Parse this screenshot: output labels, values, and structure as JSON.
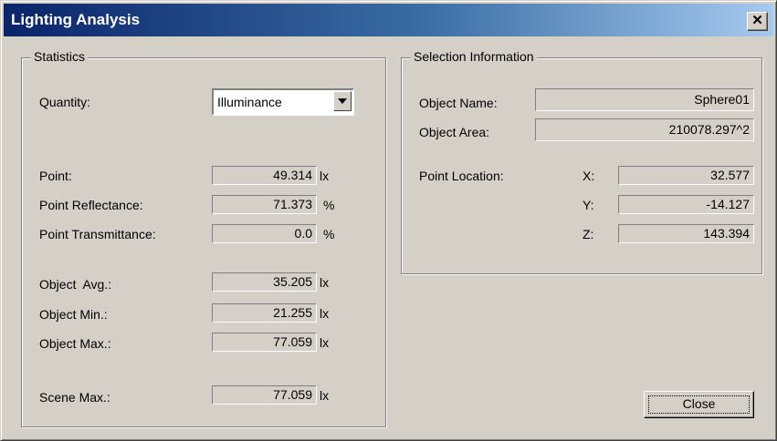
{
  "window": {
    "title": "Lighting Analysis",
    "close_glyph": "✕"
  },
  "statistics": {
    "title": "Statistics",
    "quantity_label": "Quantity:",
    "quantity_value": "Illuminance",
    "rows": [
      {
        "label": "Point:",
        "value": "49.314",
        "unit": "lx"
      },
      {
        "label": "Point Reflectance:",
        "value": "71.373",
        "unit": "%"
      },
      {
        "label": "Point Transmittance:",
        "value": "0.0",
        "unit": "%"
      },
      {
        "label": "Object  Avg.:",
        "value": "35.205",
        "unit": "lx"
      },
      {
        "label": "Object Min.:",
        "value": "21.255",
        "unit": "lx"
      },
      {
        "label": "Object Max.:",
        "value": "77.059",
        "unit": "lx"
      },
      {
        "label": "Scene Max.:",
        "value": "77.059",
        "unit": "lx"
      }
    ]
  },
  "selection": {
    "title": "Selection Information",
    "object_name_label": "Object Name:",
    "object_name": "Sphere01",
    "object_area_label": "Object Area:",
    "object_area": "210078.297^2",
    "point_location_label": "Point Location:",
    "x_label": "X:",
    "x": "32.577",
    "y_label": "Y:",
    "y": "-14.127",
    "z_label": "Z:",
    "z": "143.394"
  },
  "buttons": {
    "close": "Close"
  }
}
